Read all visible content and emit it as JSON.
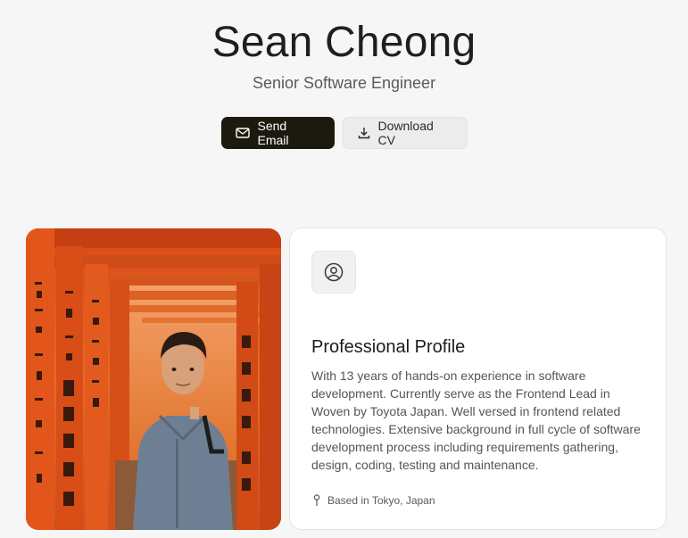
{
  "hero": {
    "name": "Sean Cheong",
    "title": "Senior Software Engineer"
  },
  "actions": {
    "send_email": {
      "label": "Send Email",
      "icon": "mail-icon"
    },
    "download_cv": {
      "label": "Download CV",
      "icon": "download-icon"
    }
  },
  "photo": {
    "subject": "portrait-photo",
    "colors": {
      "gate": "#e2551c",
      "gate_dark": "#b63d12",
      "shirt": "#6f7f93"
    }
  },
  "profile": {
    "icon": "user-circle-icon",
    "heading": "Professional Profile",
    "body": "With 13 years of hands-on experience in software development. Currently serve as the Frontend Lead in Woven by Toyota Japan. Well versed in frontend related technologies. Extensive background in full cycle of software development process including requirements gathering, design, coding, testing and maintenance.",
    "location": "Based in Tokyo, Japan",
    "location_icon": "map-pin-icon"
  },
  "colors": {
    "primary_button": "#1c1a0e",
    "background": "#f6f6f6"
  }
}
